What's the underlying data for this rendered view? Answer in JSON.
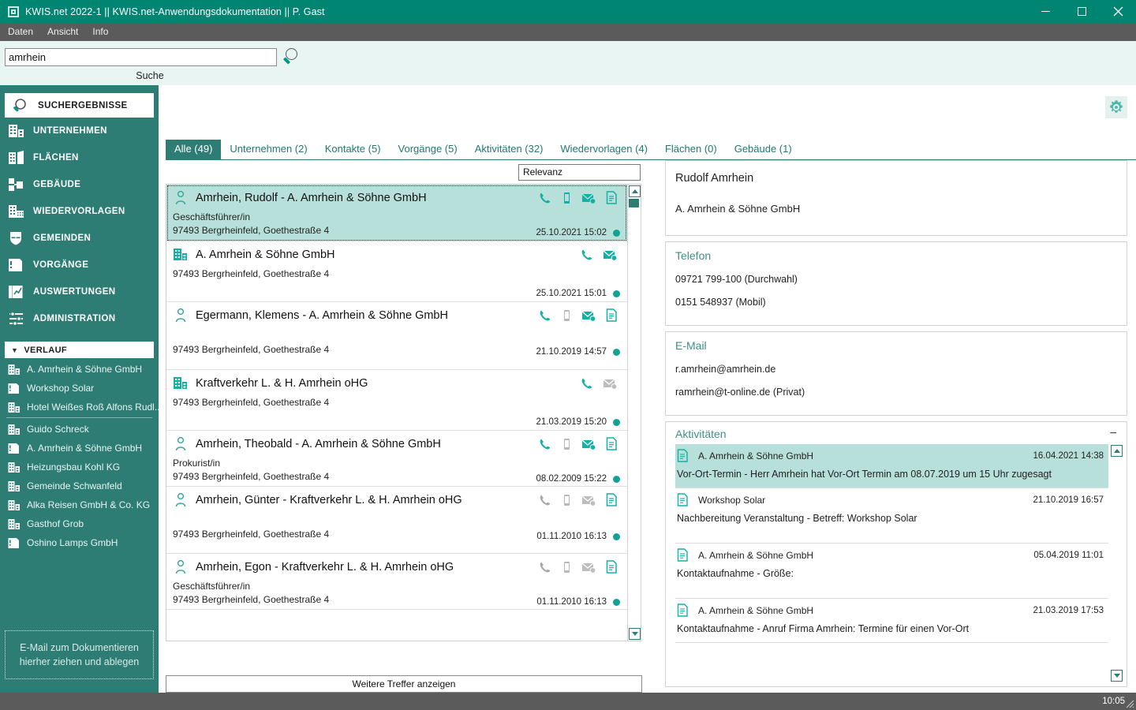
{
  "window": {
    "title": "KWIS.net 2022-1 || KWIS.net-Anwendungsdokumentation || P. Gast",
    "minimize": "—",
    "maximize": "□",
    "close": "✕"
  },
  "menubar": {
    "items": [
      "Daten",
      "Ansicht",
      "Info"
    ]
  },
  "search": {
    "value": "amrhein",
    "placeholder": "",
    "label": "Suche",
    "icon": "search-icon"
  },
  "sidebar": {
    "items": [
      {
        "label": "SUCHERGEBNISSE",
        "icon": "search-icon",
        "active": true
      },
      {
        "label": "UNTERNEHMEN",
        "icon": "building-icon",
        "active": false
      },
      {
        "label": "FLÄCHEN",
        "icon": "area-icon",
        "active": false
      },
      {
        "label": "GEBÄUDE",
        "icon": "structure-icon",
        "active": false
      },
      {
        "label": "WIEDERVORLAGEN",
        "icon": "calendar-building-icon",
        "active": false
      },
      {
        "label": "GEMEINDEN",
        "icon": "shield-icon",
        "active": false
      },
      {
        "label": "VORGÄNGE",
        "icon": "folder-icon",
        "active": false
      },
      {
        "label": "AUSWERTUNGEN",
        "icon": "chart-icon",
        "active": false
      },
      {
        "label": "ADMINISTRATION",
        "icon": "sliders-icon",
        "active": false
      }
    ],
    "history_header": "VERLAUF",
    "history": [
      {
        "label": "A. Amrhein & Söhne GmbH",
        "icon": "building-icon"
      },
      {
        "label": "Workshop Solar",
        "icon": "folder-icon"
      },
      {
        "label": "Hotel Weißes Roß Alfons Rudl...",
        "icon": "building-icon"
      },
      {
        "label": "Guido Schreck",
        "icon": "building-icon",
        "separator_before": true
      },
      {
        "label": "A. Amrhein & Söhne GmbH",
        "icon": "folder-icon"
      },
      {
        "label": "Heizungsbau Kohl KG",
        "icon": "building-icon"
      },
      {
        "label": "Gemeinde Schwanfeld",
        "icon": "building-icon"
      },
      {
        "label": "Alka Reisen GmbH & Co. KG",
        "icon": "building-icon"
      },
      {
        "label": "Gasthof Grob",
        "icon": "building-icon"
      },
      {
        "label": "Oshino Lamps GmbH",
        "icon": "folder-icon"
      }
    ],
    "dropzone_line1": "E-Mail  zum Dokumentieren",
    "dropzone_line2": "hierher ziehen und ablegen"
  },
  "tabs": [
    {
      "label": "Alle (49)",
      "active": true
    },
    {
      "label": "Unternehmen (2)",
      "active": false
    },
    {
      "label": "Kontakte (5)",
      "active": false
    },
    {
      "label": "Vorgänge (5)",
      "active": false
    },
    {
      "label": "Aktivitäten (32)",
      "active": false
    },
    {
      "label": "Wiedervorlagen (4)",
      "active": false
    },
    {
      "label": "Flächen (0)",
      "active": false
    },
    {
      "label": "Gebäude (1)",
      "active": false
    }
  ],
  "results": {
    "sort_value": "Relevanz",
    "more_button": "Weitere Treffer anzeigen",
    "items": [
      {
        "title": "Amrhein, Rudolf - A. Amrhein & Söhne GmbH",
        "type": "contact",
        "role": "Geschäftsführer/in",
        "address": "97493 Bergrheinfeld, Goethestraße 4",
        "date": "25.10.2021 15:02",
        "selected": true,
        "actions": [
          "phone-icon",
          "mobile-icon",
          "email-icon",
          "document-icon"
        ],
        "actions_enabled": [
          true,
          true,
          true,
          true
        ]
      },
      {
        "title": "A. Amrhein & Söhne GmbH",
        "type": "company",
        "role": "",
        "address": "97493 Bergrheinfeld, Goethestraße 4",
        "date": "25.10.2021 15:01",
        "selected": false,
        "actions": [
          "phone-icon",
          "email-icon"
        ],
        "actions_enabled": [
          true,
          true
        ]
      },
      {
        "title": "Egermann, Klemens - A. Amrhein & Söhne GmbH",
        "type": "contact",
        "role": "",
        "address": "97493 Bergrheinfeld, Goethestraße 4",
        "date": "21.10.2019 14:57",
        "selected": false,
        "actions": [
          "phone-icon",
          "mobile-icon",
          "email-icon",
          "document-icon"
        ],
        "actions_enabled": [
          true,
          false,
          true,
          true
        ]
      },
      {
        "title": "Kraftverkehr L. & H. Amrhein oHG",
        "type": "company",
        "role": "",
        "address": "97493 Bergrheinfeld, Goethestraße 4",
        "date": "21.03.2019 15:20",
        "selected": false,
        "actions": [
          "phone-icon",
          "email-icon"
        ],
        "actions_enabled": [
          true,
          false
        ]
      },
      {
        "title": "Amrhein, Theobald - A. Amrhein & Söhne GmbH",
        "type": "contact",
        "role": "Prokurist/in",
        "address": "97493 Bergrheinfeld, Goethestraße 4",
        "date": "08.02.2009 15:22",
        "selected": false,
        "actions": [
          "phone-icon",
          "mobile-icon",
          "email-icon",
          "document-icon"
        ],
        "actions_enabled": [
          true,
          false,
          true,
          true
        ]
      },
      {
        "title": "Amrhein, Günter - Kraftverkehr L. & H. Amrhein oHG",
        "type": "contact",
        "role": "",
        "address": "97493 Bergrheinfeld, Goethestraße 4",
        "date": "01.11.2010 16:13",
        "selected": false,
        "actions": [
          "phone-icon",
          "mobile-icon",
          "email-icon",
          "document-icon"
        ],
        "actions_enabled": [
          false,
          false,
          false,
          true
        ]
      },
      {
        "title": "Amrhein, Egon - Kraftverkehr L. & H. Amrhein oHG",
        "type": "contact",
        "role": "Geschäftsführer/in",
        "address": "97493 Bergrheinfeld, Goethestraße 4",
        "date": "01.11.2010 16:13",
        "selected": false,
        "actions": [
          "phone-icon",
          "mobile-icon",
          "email-icon",
          "document-icon"
        ],
        "actions_enabled": [
          false,
          false,
          false,
          true
        ]
      }
    ]
  },
  "detail": {
    "name": "Rudolf Amrhein",
    "company": "A. Amrhein & Söhne GmbH",
    "phone": {
      "title": "Telefon",
      "lines": [
        "09721 799-100 (Durchwahl)",
        "0151 548937 (Mobil)"
      ]
    },
    "email": {
      "title": "E-Mail",
      "lines": [
        "r.amrhein@amrhein.de",
        "ramrhein@t-online.de (Privat)"
      ]
    },
    "activities": {
      "title": "Aktivitäten",
      "collapse": "−",
      "items": [
        {
          "name": "A. Amrhein & Söhne GmbH",
          "date": "16.04.2021 14:38",
          "text": "Vor-Ort-Termin - Herr Amrhein hat Vor-Ort Termin am 08.07.2019 um 15 Uhr zugesagt",
          "selected": true
        },
        {
          "name": "Workshop Solar",
          "date": "21.10.2019 16:57",
          "text": "Nachbereitung Veranstaltung - Betreff: Workshop Solar",
          "selected": false
        },
        {
          "name": "A. Amrhein & Söhne GmbH",
          "date": "05.04.2019 11:01",
          "text": "Kontaktaufnahme - Größe:",
          "selected": false
        },
        {
          "name": "A. Amrhein & Söhne GmbH",
          "date": "21.03.2019 17:53",
          "text": "Kontaktaufnahme - Anruf Firma Amrhein: Termine für einen Vor-Ort",
          "selected": false
        }
      ]
    }
  },
  "settings_icon": "gear-icon",
  "statusbar": {
    "time": "10:05"
  },
  "colors": {
    "title_bar": "#008573",
    "sidebar": "#2d7d74",
    "accent": "#12a195",
    "selection": "#b7e0da",
    "menu_bar": "#5b5b5b",
    "search_bar": "#e8f5f2"
  }
}
